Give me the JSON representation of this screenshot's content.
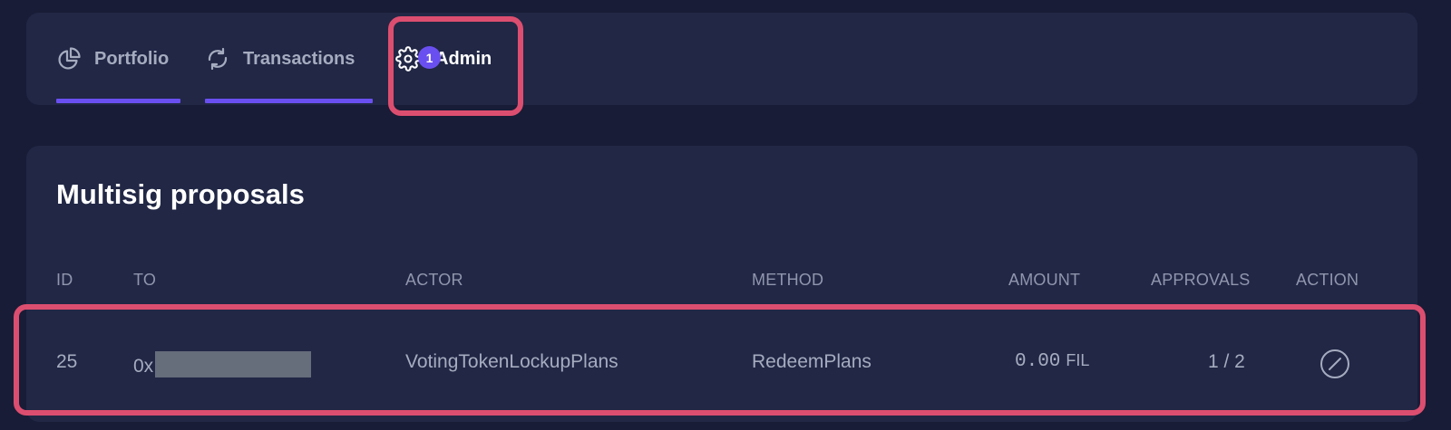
{
  "tabs": [
    {
      "label": "Portfolio",
      "icon": "pie-chart-icon"
    },
    {
      "label": "Transactions",
      "icon": "refresh-icon"
    },
    {
      "label": "Admin",
      "icon": "gear-icon",
      "badge": "1",
      "active": true
    }
  ],
  "proposals": {
    "title": "Multisig proposals",
    "columns": [
      "ID",
      "TO",
      "ACTOR",
      "METHOD",
      "AMOUNT",
      "APPROVALS",
      "ACTION"
    ],
    "rows": [
      {
        "id": "25",
        "to_prefix": "0x",
        "actor": "VotingTokenLockupPlans",
        "method": "RedeemPlans",
        "amount": "0.00",
        "amount_unit": "FIL",
        "approvals": "1 / 2",
        "action_icon": "cancel-circle-icon"
      }
    ]
  },
  "colors": {
    "background": "#181c36",
    "panel": "#212745",
    "accent": "#6a4ff0",
    "highlight": "#dc4e6f",
    "muted_text": "#a6acbf"
  }
}
